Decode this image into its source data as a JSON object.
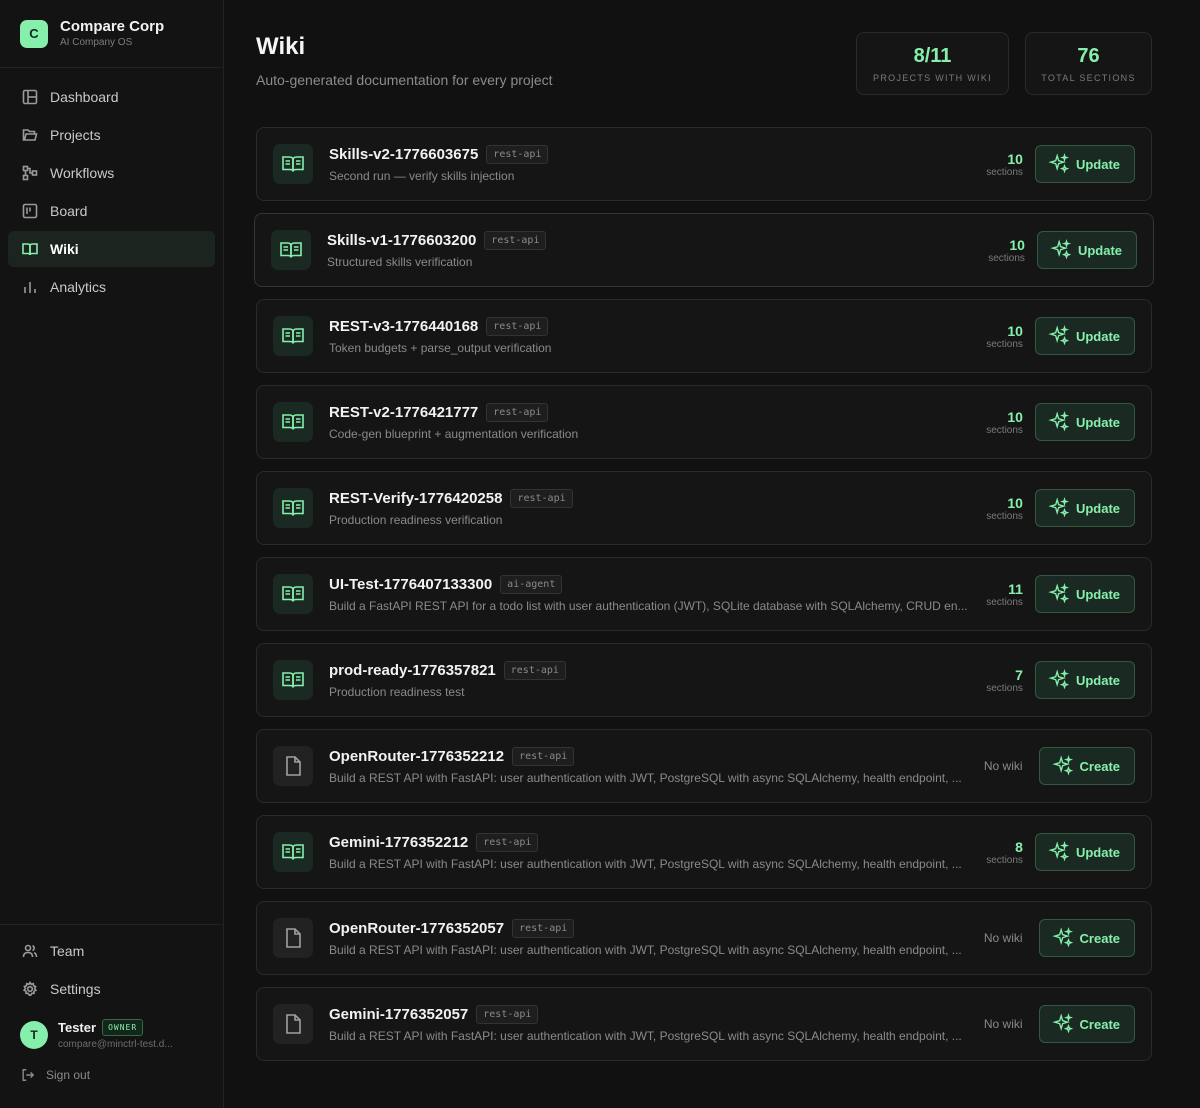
{
  "brand": {
    "logo_letter": "C",
    "name": "Compare Corp",
    "subtitle": "AI Company OS"
  },
  "nav": [
    {
      "label": "Dashboard",
      "icon": "layout-icon",
      "active": false
    },
    {
      "label": "Projects",
      "icon": "folder-icon",
      "active": false
    },
    {
      "label": "Workflows",
      "icon": "workflow-icon",
      "active": false
    },
    {
      "label": "Board",
      "icon": "board-icon",
      "active": false
    },
    {
      "label": "Wiki",
      "icon": "book-icon",
      "active": true
    },
    {
      "label": "Analytics",
      "icon": "bar-chart-icon",
      "active": false
    }
  ],
  "bottom_nav": [
    {
      "label": "Team",
      "icon": "users-icon"
    },
    {
      "label": "Settings",
      "icon": "gear-icon"
    }
  ],
  "user": {
    "initial": "T",
    "name": "Tester",
    "role": "OWNER",
    "email": "compare@minctrl-test.d..."
  },
  "signout_label": "Sign out",
  "page": {
    "title": "Wiki",
    "subtitle": "Auto-generated documentation for every project"
  },
  "stats": [
    {
      "value": "8/11",
      "label": "PROJECTS WITH WIKI"
    },
    {
      "value": "76",
      "label": "TOTAL SECTIONS"
    }
  ],
  "colors": {
    "accent": "#86efac",
    "background": "#111111",
    "card": "#151515"
  },
  "projects": [
    {
      "name": "Skills-v2-1776603675",
      "tag": "rest-api",
      "description": "Second run — verify skills injection",
      "has_wiki": true,
      "sections": "10",
      "sections_label": "sections",
      "action": "Update"
    },
    {
      "name": "Skills-v1-1776603200",
      "tag": "rest-api",
      "description": "Structured skills verification",
      "has_wiki": true,
      "sections": "10",
      "sections_label": "sections",
      "action": "Update"
    },
    {
      "name": "REST-v3-1776440168",
      "tag": "rest-api",
      "description": "Token budgets + parse_output verification",
      "has_wiki": true,
      "sections": "10",
      "sections_label": "sections",
      "action": "Update"
    },
    {
      "name": "REST-v2-1776421777",
      "tag": "rest-api",
      "description": "Code-gen blueprint + augmentation verification",
      "has_wiki": true,
      "sections": "10",
      "sections_label": "sections",
      "action": "Update"
    },
    {
      "name": "REST-Verify-1776420258",
      "tag": "rest-api",
      "description": "Production readiness verification",
      "has_wiki": true,
      "sections": "10",
      "sections_label": "sections",
      "action": "Update"
    },
    {
      "name": "UI-Test-1776407133300",
      "tag": "ai-agent",
      "description": "Build a FastAPI REST API for a todo list with user authentication (JWT), SQLite database with SQLAlchemy, CRUD en...",
      "has_wiki": true,
      "sections": "11",
      "sections_label": "sections",
      "action": "Update"
    },
    {
      "name": "prod-ready-1776357821",
      "tag": "rest-api",
      "description": "Production readiness test",
      "has_wiki": true,
      "sections": "7",
      "sections_label": "sections",
      "action": "Update"
    },
    {
      "name": "OpenRouter-1776352212",
      "tag": "rest-api",
      "description": "Build a REST API with FastAPI: user authentication with JWT, PostgreSQL with async SQLAlchemy, health endpoint, ...",
      "has_wiki": false,
      "status": "No wiki",
      "action": "Create"
    },
    {
      "name": "Gemini-1776352212",
      "tag": "rest-api",
      "description": "Build a REST API with FastAPI: user authentication with JWT, PostgreSQL with async SQLAlchemy, health endpoint, ...",
      "has_wiki": true,
      "sections": "8",
      "sections_label": "sections",
      "action": "Update"
    },
    {
      "name": "OpenRouter-1776352057",
      "tag": "rest-api",
      "description": "Build a REST API with FastAPI: user authentication with JWT, PostgreSQL with async SQLAlchemy, health endpoint, ...",
      "has_wiki": false,
      "status": "No wiki",
      "action": "Create"
    },
    {
      "name": "Gemini-1776352057",
      "tag": "rest-api",
      "description": "Build a REST API with FastAPI: user authentication with JWT, PostgreSQL with async SQLAlchemy, health endpoint, ...",
      "has_wiki": false,
      "status": "No wiki",
      "action": "Create"
    }
  ]
}
